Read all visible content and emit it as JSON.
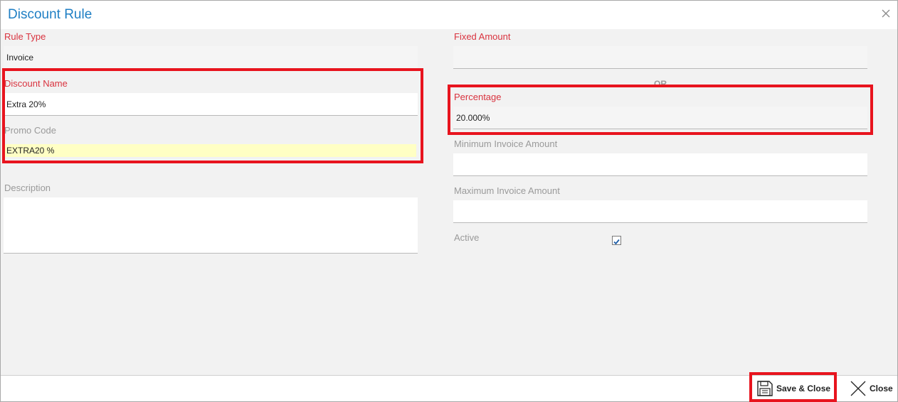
{
  "dialog": {
    "title": "Discount Rule"
  },
  "left": {
    "rule_type": {
      "label": "Rule Type",
      "value": "Invoice"
    },
    "discount_name": {
      "label": "Discount Name",
      "value": "Extra 20%"
    },
    "promo_code": {
      "label": "Promo Code",
      "value": "EXTRA20 %"
    },
    "description": {
      "label": "Description",
      "value": ""
    }
  },
  "right": {
    "fixed_amount": {
      "label": "Fixed Amount",
      "value": ""
    },
    "or_text": "OR",
    "percentage": {
      "label": "Percentage",
      "value": "20.000%"
    },
    "min_invoice": {
      "label": "Minimum Invoice Amount",
      "value": ""
    },
    "max_invoice": {
      "label": "Maximum Invoice Amount",
      "value": ""
    },
    "active": {
      "label": "Active",
      "checked": true
    }
  },
  "footer": {
    "save_label": "Save & Close",
    "close_label": "Close"
  },
  "colors": {
    "accent": "#1f7fc4",
    "required": "#d9333f",
    "highlight": "#e8141e",
    "promo_bg": "#ffffc4"
  }
}
